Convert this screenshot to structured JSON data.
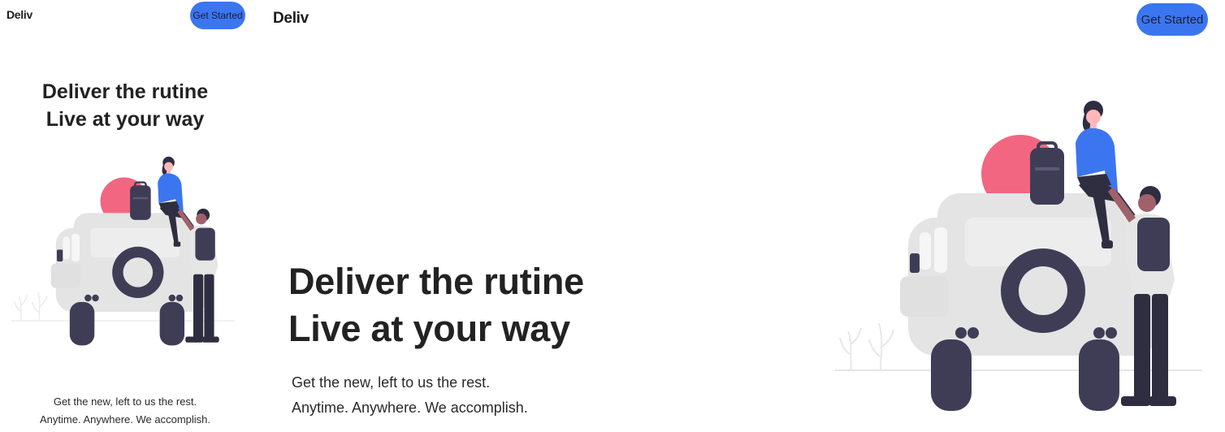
{
  "mobile": {
    "logo": "Deliv",
    "cta_label": "Get Started",
    "headline_line1": "Deliver the rutine",
    "headline_line2": "Live at your way",
    "sub_line1": "Get the new, left to us the rest.",
    "sub_line2": "Anytime. Anywhere. We accomplish."
  },
  "desktop": {
    "logo": "Deliv",
    "cta_label": "Get Started",
    "headline_line1": "Deliver the rutine",
    "headline_line2": "Live at your way",
    "sub_line1": "Get the new, left to us the rest.",
    "sub_line2": "Anytime. Anywhere. We accomplish."
  },
  "colors": {
    "accent": "#3b76f0",
    "sun": "#f26681",
    "jeep": "#e4e4e4",
    "dark": "#3f3d56",
    "shirt": "#3b76f0"
  },
  "illustration": {
    "icon": "people-on-jeep-illustration"
  }
}
